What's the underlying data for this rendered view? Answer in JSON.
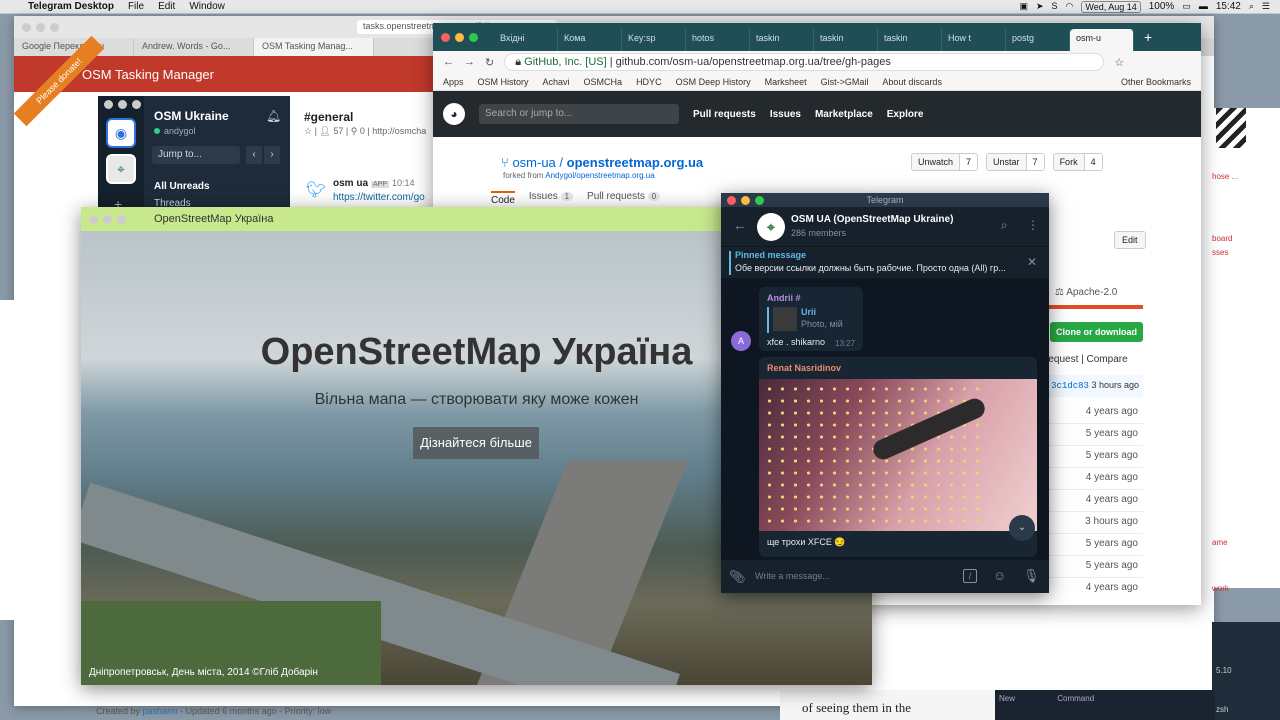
{
  "menubar": {
    "app": "Telegram Desktop",
    "menus": [
      "File",
      "Edit",
      "Window"
    ],
    "date": "Wed, Aug 14",
    "battery": "100%",
    "time": "15:42"
  },
  "back_browser": {
    "url": "tasks.openstreetmap.org.ua/?dir",
    "tabs": [
      "Google Перекладач",
      "Andrew. Words - Go...",
      "OSM Tasking Manag..."
    ],
    "header": "OSM Tasking Manager",
    "donate": "Please donate!",
    "footer_prefix": "Created by",
    "footer_user": "pasharm",
    "footer_suffix": "- Updated 6 months ago - Priority: low"
  },
  "slack": {
    "team": "OSM Ukraine",
    "user": "andygol",
    "jump": "Jump to...",
    "all_unreads": "All Unreads",
    "threads": "Threads",
    "channel": "#general",
    "members": "57",
    "pins": "0",
    "topic": "http://osmcha",
    "msg_from": "osm ua",
    "app_badge": "APP",
    "msg_time": "10:14",
    "msg_link": "https://twitter.com/go"
  },
  "osm_window": {
    "title": "OpenStreetMap Україна",
    "heading": "OpenStreetMap Україна",
    "subheading": "Вільна мапа — створювати яку може кожен",
    "button": "Дізнайтеся більше",
    "caption": "Дніпропетровськ, День міста, 2014 ©Гліб Добарін"
  },
  "github": {
    "tabs": [
      "Вхідні",
      "Кома",
      "Key:sp",
      "hotos",
      "taskin",
      "taskin",
      "taskin",
      "How t",
      "postg",
      "osm-u"
    ],
    "cert": "GitHub, Inc. [US]",
    "url_host": "github.com",
    "url_path": "/osm-ua/openstreetmap.org.ua/tree/gh-pages",
    "bookmarks": [
      "Apps",
      "OSM History",
      "Achavi",
      "OSMCHa",
      "HDYC",
      "OSM Deep History",
      "Marksheet",
      "Gist->GMail",
      "About discards",
      "Other Bookmarks"
    ],
    "search": "Search or jump to...",
    "nav": [
      "Pull requests",
      "Issues",
      "Marketplace",
      "Explore"
    ],
    "owner": "osm-ua",
    "repo": "openstreetmap.org.ua",
    "forked_prefix": "forked from",
    "forked_from": "Andygol/openstreetmap.org.ua",
    "unwatch": "Unwatch",
    "unwatch_count": "7",
    "unstar": "Unstar",
    "unstar_count": "7",
    "fork": "Fork",
    "fork_count": "4",
    "repo_tabs": [
      {
        "label": "Code",
        "count": ""
      },
      {
        "label": "Issues",
        "count": "1"
      },
      {
        "label": "Pull requests",
        "count": "0"
      }
    ],
    "edit": "Edit",
    "license": "Apache-2.0",
    "clone": "Clone or download",
    "pull_request": "request",
    "compare": "Compare",
    "commit_hash": "3c1dc83",
    "commit_age": "3 hours ago",
    "ages": [
      "4 years ago",
      "5 years ago",
      "5 years ago",
      "4 years ago",
      "4 years ago",
      "3 hours ago",
      "5 years ago",
      "5 years ago",
      "4 years ago"
    ]
  },
  "telegram": {
    "window_title": "Telegram",
    "chat_name": "OSM UA (OpenStreetMap Ukraine)",
    "members": "286 members",
    "pinned_label": "Pinned message",
    "pinned_text": "Обе версии ссылки должны быть рабочие. Просто одна (All) гр...",
    "msg1_author": "Andrii #",
    "msg1_reply_name": "Urii",
    "msg1_reply_text": "Photo, мій",
    "msg1_text": "xfce . shikarno",
    "msg1_time": "13:27",
    "avatar_a": "A",
    "msg2_author": "Renat Nasridinov",
    "msg2_text": "ще трохи XFCE 😏",
    "input_placeholder": "Write a message..."
  },
  "right_edge": {
    "txt1": "hose ...",
    "txt2": "board",
    "txt3": "sses",
    "txt4": "ame",
    "txt5": "work",
    "term_line": "5.10",
    "term_zsh": "zsh"
  },
  "bottom": {
    "book_text": "of seeing them in the",
    "term_new": "New",
    "term_cmd": "Command"
  }
}
